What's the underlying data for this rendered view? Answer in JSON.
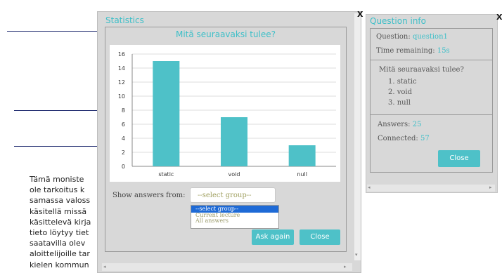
{
  "background": {
    "text_lines": [
      "Tämä moniste ",
      "ole tarkoitus k",
      "samassa valoss",
      "käsitellä missä",
      "käsittelevä kirja",
      "tieto löytyy tiet",
      "saatavilla olev",
      "aloittelijoille tar",
      "kielen kommun"
    ]
  },
  "statistics": {
    "title": "Statistics",
    "close_x": "X",
    "show_answers_label": "Show answers from:",
    "select_value": "--select group--",
    "options": [
      "--select group--",
      "Current lecture",
      "All answers"
    ],
    "ask_again_label": "Ask again",
    "close_label": "Close"
  },
  "chart_data": {
    "type": "bar",
    "title": "Mitä seuraavaksi tulee?",
    "categories": [
      "static",
      "void",
      "null"
    ],
    "values": [
      15,
      7,
      3
    ],
    "ylim": [
      0,
      16
    ],
    "yticks": [
      0,
      2,
      4,
      6,
      8,
      10,
      12,
      14,
      16
    ],
    "grid": true,
    "bar_color": "#4ec1c8"
  },
  "question_info": {
    "title": "Question info",
    "close_x": "X",
    "question_label": "Question:",
    "question_value": "question1",
    "time_label": "Time remaining:",
    "time_value": "15s",
    "question_text": "Mitä seuraavaksi tulee?",
    "answers": [
      "1. static",
      "2. void",
      "3. null"
    ],
    "answers_label": "Answers:",
    "answers_value": "25",
    "connected_label": "Connected:",
    "connected_value": "57",
    "close_label": "Close"
  },
  "colors": {
    "accent": "#3dbfc8",
    "button": "#4ec1c8",
    "selection": "#1e6ad6"
  }
}
